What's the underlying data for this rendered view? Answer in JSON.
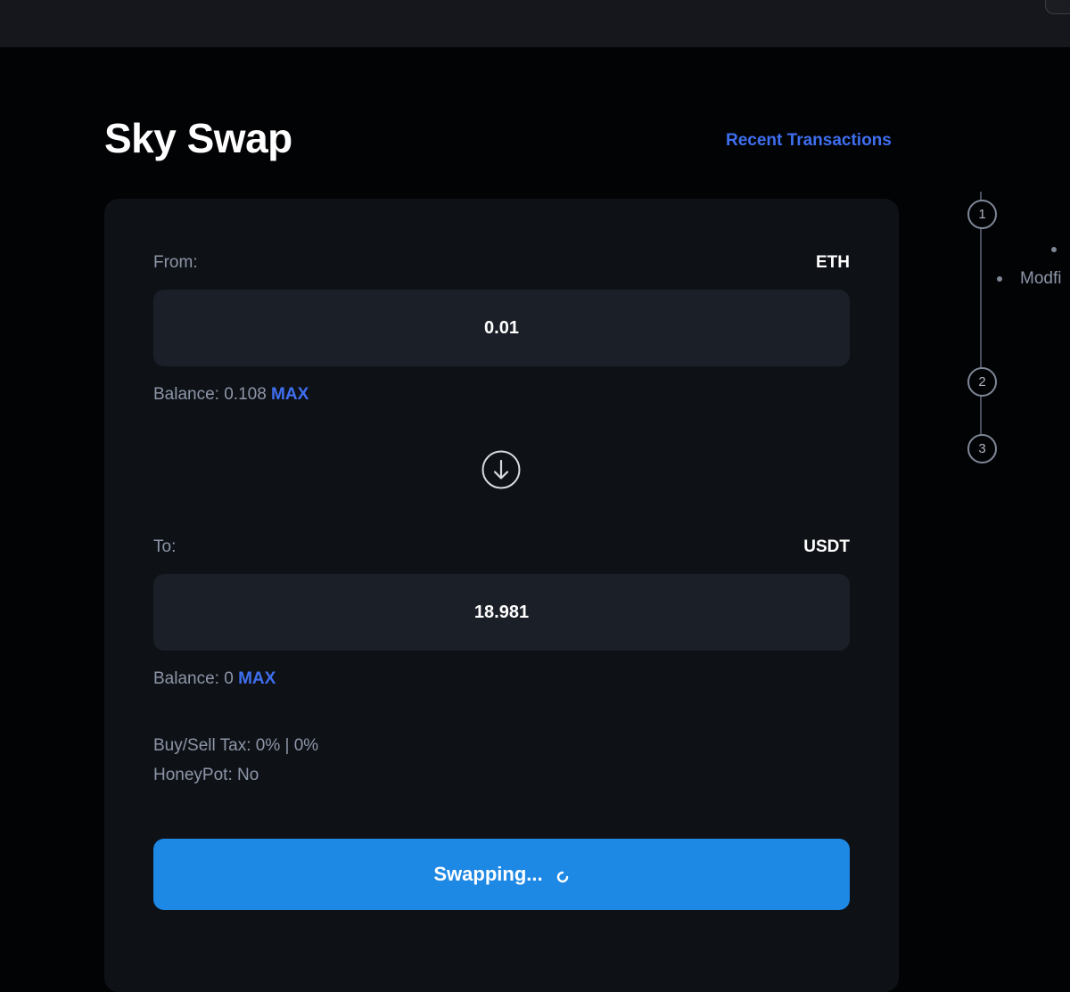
{
  "app": {
    "title": "Sky Swap",
    "recent_link": "Recent Transactions"
  },
  "from": {
    "label": "From:",
    "token": "ETH",
    "amount": "0.01",
    "balance_label": "Balance: 0.108",
    "max_label": "MAX"
  },
  "to": {
    "label": "To:",
    "token": "USDT",
    "amount": "18.981",
    "balance_label": "Balance: 0",
    "max_label": "MAX"
  },
  "info": {
    "tax": "Buy/Sell Tax: 0% | 0%",
    "honeypot": "HoneyPot: No"
  },
  "swap_button": {
    "label": "Swapping..."
  },
  "steps": {
    "items": [
      "1",
      "2",
      "3"
    ],
    "note": "Modfi"
  },
  "icons": {
    "swap_direction": "arrow-down-circle-icon",
    "loading": "spinner-icon"
  },
  "colors": {
    "accent_link": "#3f6ff0",
    "button": "#1e88e5",
    "card": "#0e1116",
    "input": "#1b1f27"
  }
}
